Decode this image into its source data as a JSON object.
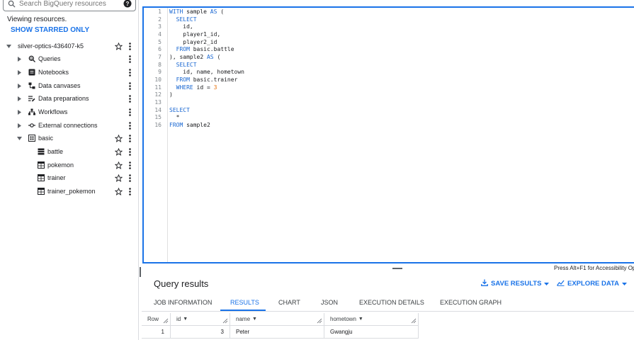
{
  "explorer": {
    "search_placeholder": "Search BigQuery resources",
    "viewing_text": "Viewing resources.",
    "show_starred_label": "SHOW STARRED ONLY",
    "project": "silver-optics-436407-k5",
    "items": [
      {
        "label": "Queries",
        "icon": "search-doc-icon"
      },
      {
        "label": "Notebooks",
        "icon": "notebook-icon"
      },
      {
        "label": "Data canvases",
        "icon": "canvas-icon"
      },
      {
        "label": "Data preparations",
        "icon": "data-prep-icon"
      },
      {
        "label": "Workflows",
        "icon": "workflow-icon"
      },
      {
        "label": "External connections",
        "icon": "connection-icon"
      }
    ],
    "dataset": "basic",
    "tables": [
      "battle",
      "pokemon",
      "trainer",
      "trainer_pokemon"
    ]
  },
  "editor": {
    "line_numbers": [
      "1",
      "2",
      "3",
      "4",
      "5",
      "6",
      "7",
      "8",
      "9",
      "10",
      "11",
      "12",
      "13",
      "14",
      "15",
      "16"
    ]
  },
  "accessibility_hint": "Press Alt+F1 for Accessibility Op",
  "results": {
    "title": "Query results",
    "save_results_label": "SAVE RESULTS",
    "explore_data_label": "EXPLORE DATA",
    "tabs": [
      "JOB INFORMATION",
      "RESULTS",
      "CHART",
      "JSON",
      "EXECUTION DETAILS",
      "EXECUTION GRAPH"
    ],
    "active_tab": "RESULTS",
    "columns": [
      "Row",
      "id",
      "name",
      "hometown"
    ],
    "rows": [
      {
        "row": "1",
        "id": "3",
        "name": "Peter",
        "hometown": "Gwangju"
      }
    ]
  },
  "colors": {
    "accent": "#1a73e8",
    "keyword": "#1967d2",
    "number": "#e8710a"
  }
}
